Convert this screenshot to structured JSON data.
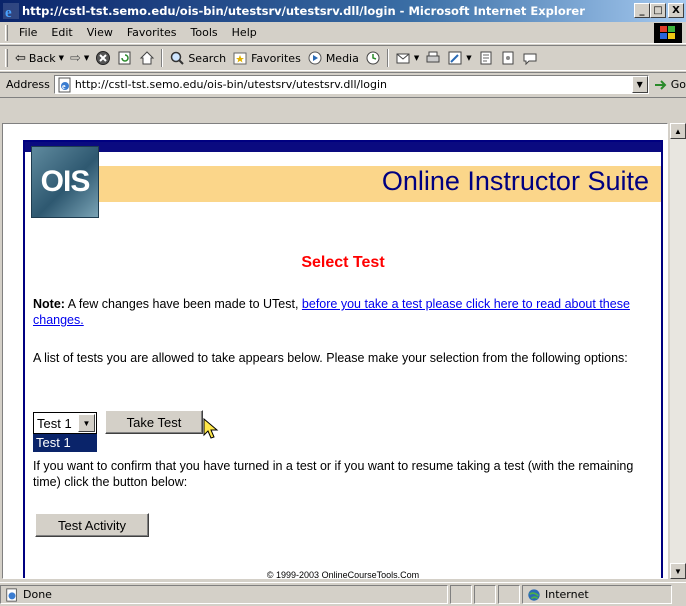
{
  "window": {
    "title": "http://cstl-tst.semo.edu/ois-bin/utestsrv/utestsrv.dll/login - Microsoft Internet Explorer",
    "buttons": [
      "_",
      "□",
      "X"
    ]
  },
  "menu": [
    "File",
    "Edit",
    "View",
    "Favorites",
    "Tools",
    "Help"
  ],
  "toolbar": {
    "back_label": "Back",
    "search_label": "Search",
    "favorites_label": "Favorites",
    "media_label": "Media"
  },
  "address": {
    "label": "Address",
    "url": "http://cstl-tst.semo.edu/ois-bin/utestsrv/utestsrv.dll/login",
    "go_label": "Go"
  },
  "page": {
    "logo_text": "OIS",
    "suite_title": "Online Instructor Suite",
    "heading": "Select Test",
    "note_bold": "Note:",
    "note_text": " A few changes have been made to UTest, ",
    "note_link": "before you take a test please click here to read about these changes.",
    "list_text": "A list of tests you are allowed to take appears below.   Please make your selection from the following options:",
    "select_value": "Test 1",
    "dropdown_option": "Test 1",
    "take_test_label": "Take Test",
    "confirm_text": "If you want to confirm that you have turned in a test or if you want to resume taking a test (with the remaining time) click the button below:",
    "activity_label": "Test Activity",
    "copyright": "© 1999-2003 OnlineCourseTools.Com"
  },
  "status": {
    "text": "Done",
    "zone": "Internet"
  }
}
